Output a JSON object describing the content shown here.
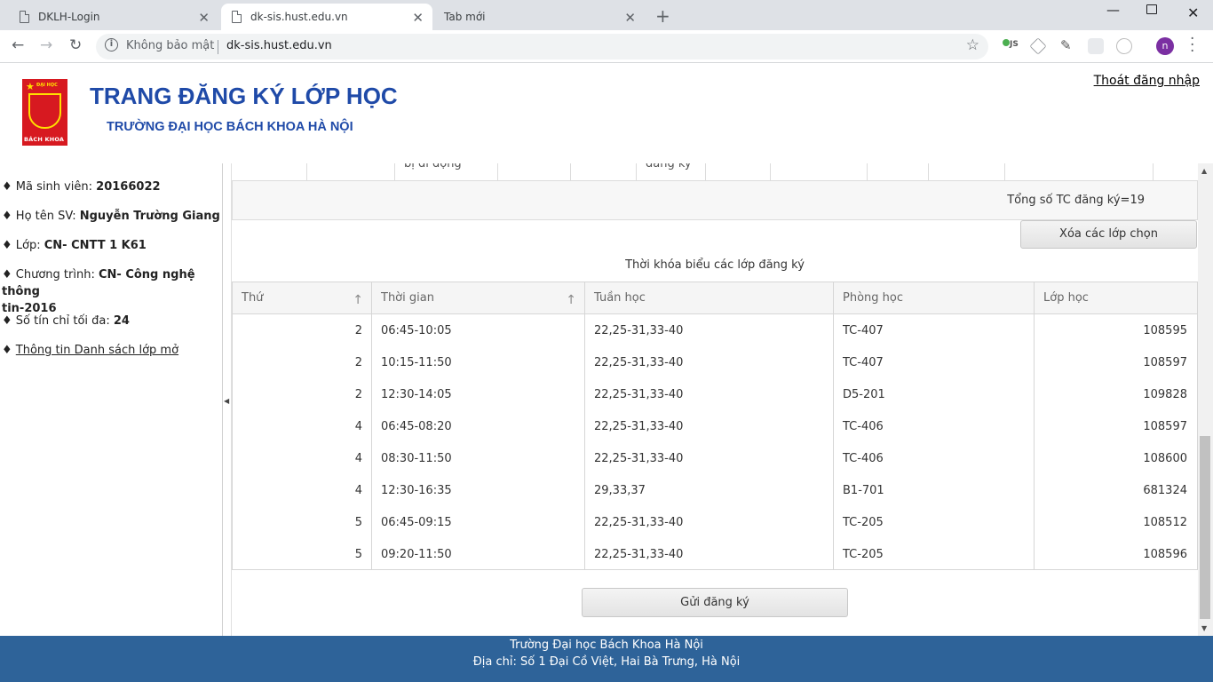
{
  "browser": {
    "tabs": [
      {
        "title": "DKLH-Login"
      },
      {
        "title": "dk-sis.hust.edu.vn"
      },
      {
        "title": "Tab mới"
      }
    ],
    "omnibox": {
      "security": "Không bảo mật",
      "url": "dk-sis.hust.edu.vn"
    },
    "profile_initial": "n",
    "extension_badge": "JS"
  },
  "header": {
    "logo_top": "ĐẠI HỌC",
    "logo_bottom": "BÁCH KHOA",
    "title": "TRANG ĐĂNG KÝ LỚP HỌC",
    "subtitle": "TRƯỜNG ĐẠI HỌC BÁCH KHOA HÀ NỘI",
    "logout": "Thoát đăng nhập"
  },
  "sidebar": {
    "student_id_label": "Mã sinh viên:",
    "student_id": "20166022",
    "name_label": "Họ tên SV:",
    "name": "Nguyễn Trường Giang",
    "class_label": "Lớp:",
    "class": "CN- CNTT 1 K61",
    "program_label": "Chương trình:",
    "program_line1": "CN- Công nghệ thông",
    "program_line2": "tin-2016",
    "max_credits_label": "Số tín chỉ tối đa:",
    "max_credits": "24",
    "open_classes_link": "Thông tin Danh sách lớp mở"
  },
  "main": {
    "prev_row_fragments": [
      "bị di động",
      "đăng ký"
    ],
    "total_credits": "Tổng số TC đăng ký=19",
    "clear_button": "Xóa các lớp chọn",
    "timetable_title": "Thời khóa biểu các lớp đăng ký",
    "columns": [
      "Thứ",
      "Thời gian",
      "Tuần học",
      "Phòng học",
      "Lớp học"
    ],
    "rows": [
      {
        "day": "2",
        "time": "06:45-10:05",
        "weeks": "22,25-31,33-40",
        "room": "TC-407",
        "class_id": "108595"
      },
      {
        "day": "2",
        "time": "10:15-11:50",
        "weeks": "22,25-31,33-40",
        "room": "TC-407",
        "class_id": "108597"
      },
      {
        "day": "2",
        "time": "12:30-14:05",
        "weeks": "22,25-31,33-40",
        "room": "D5-201",
        "class_id": "109828"
      },
      {
        "day": "4",
        "time": "06:45-08:20",
        "weeks": "22,25-31,33-40",
        "room": "TC-406",
        "class_id": "108597"
      },
      {
        "day": "4",
        "time": "08:30-11:50",
        "weeks": "22,25-31,33-40",
        "room": "TC-406",
        "class_id": "108600"
      },
      {
        "day": "4",
        "time": "12:30-16:35",
        "weeks": "29,33,37",
        "room": "B1-701",
        "class_id": "681324"
      },
      {
        "day": "5",
        "time": "06:45-09:15",
        "weeks": "22,25-31,33-40",
        "room": "TC-205",
        "class_id": "108512"
      },
      {
        "day": "5",
        "time": "09:20-11:50",
        "weeks": "22,25-31,33-40",
        "room": "TC-205",
        "class_id": "108596"
      }
    ],
    "submit_button": "Gửi đăng ký"
  },
  "footer": {
    "line1": "Trường Đại học Bách Khoa Hà Nội",
    "line2": "Địa chỉ: Số 1 Đại Cồ Việt, Hai Bà Trưng, Hà Nội"
  },
  "colors": {
    "brand_blue": "#1f4aa8",
    "footer_bg": "#2e6399",
    "logo_red": "#d71920"
  }
}
